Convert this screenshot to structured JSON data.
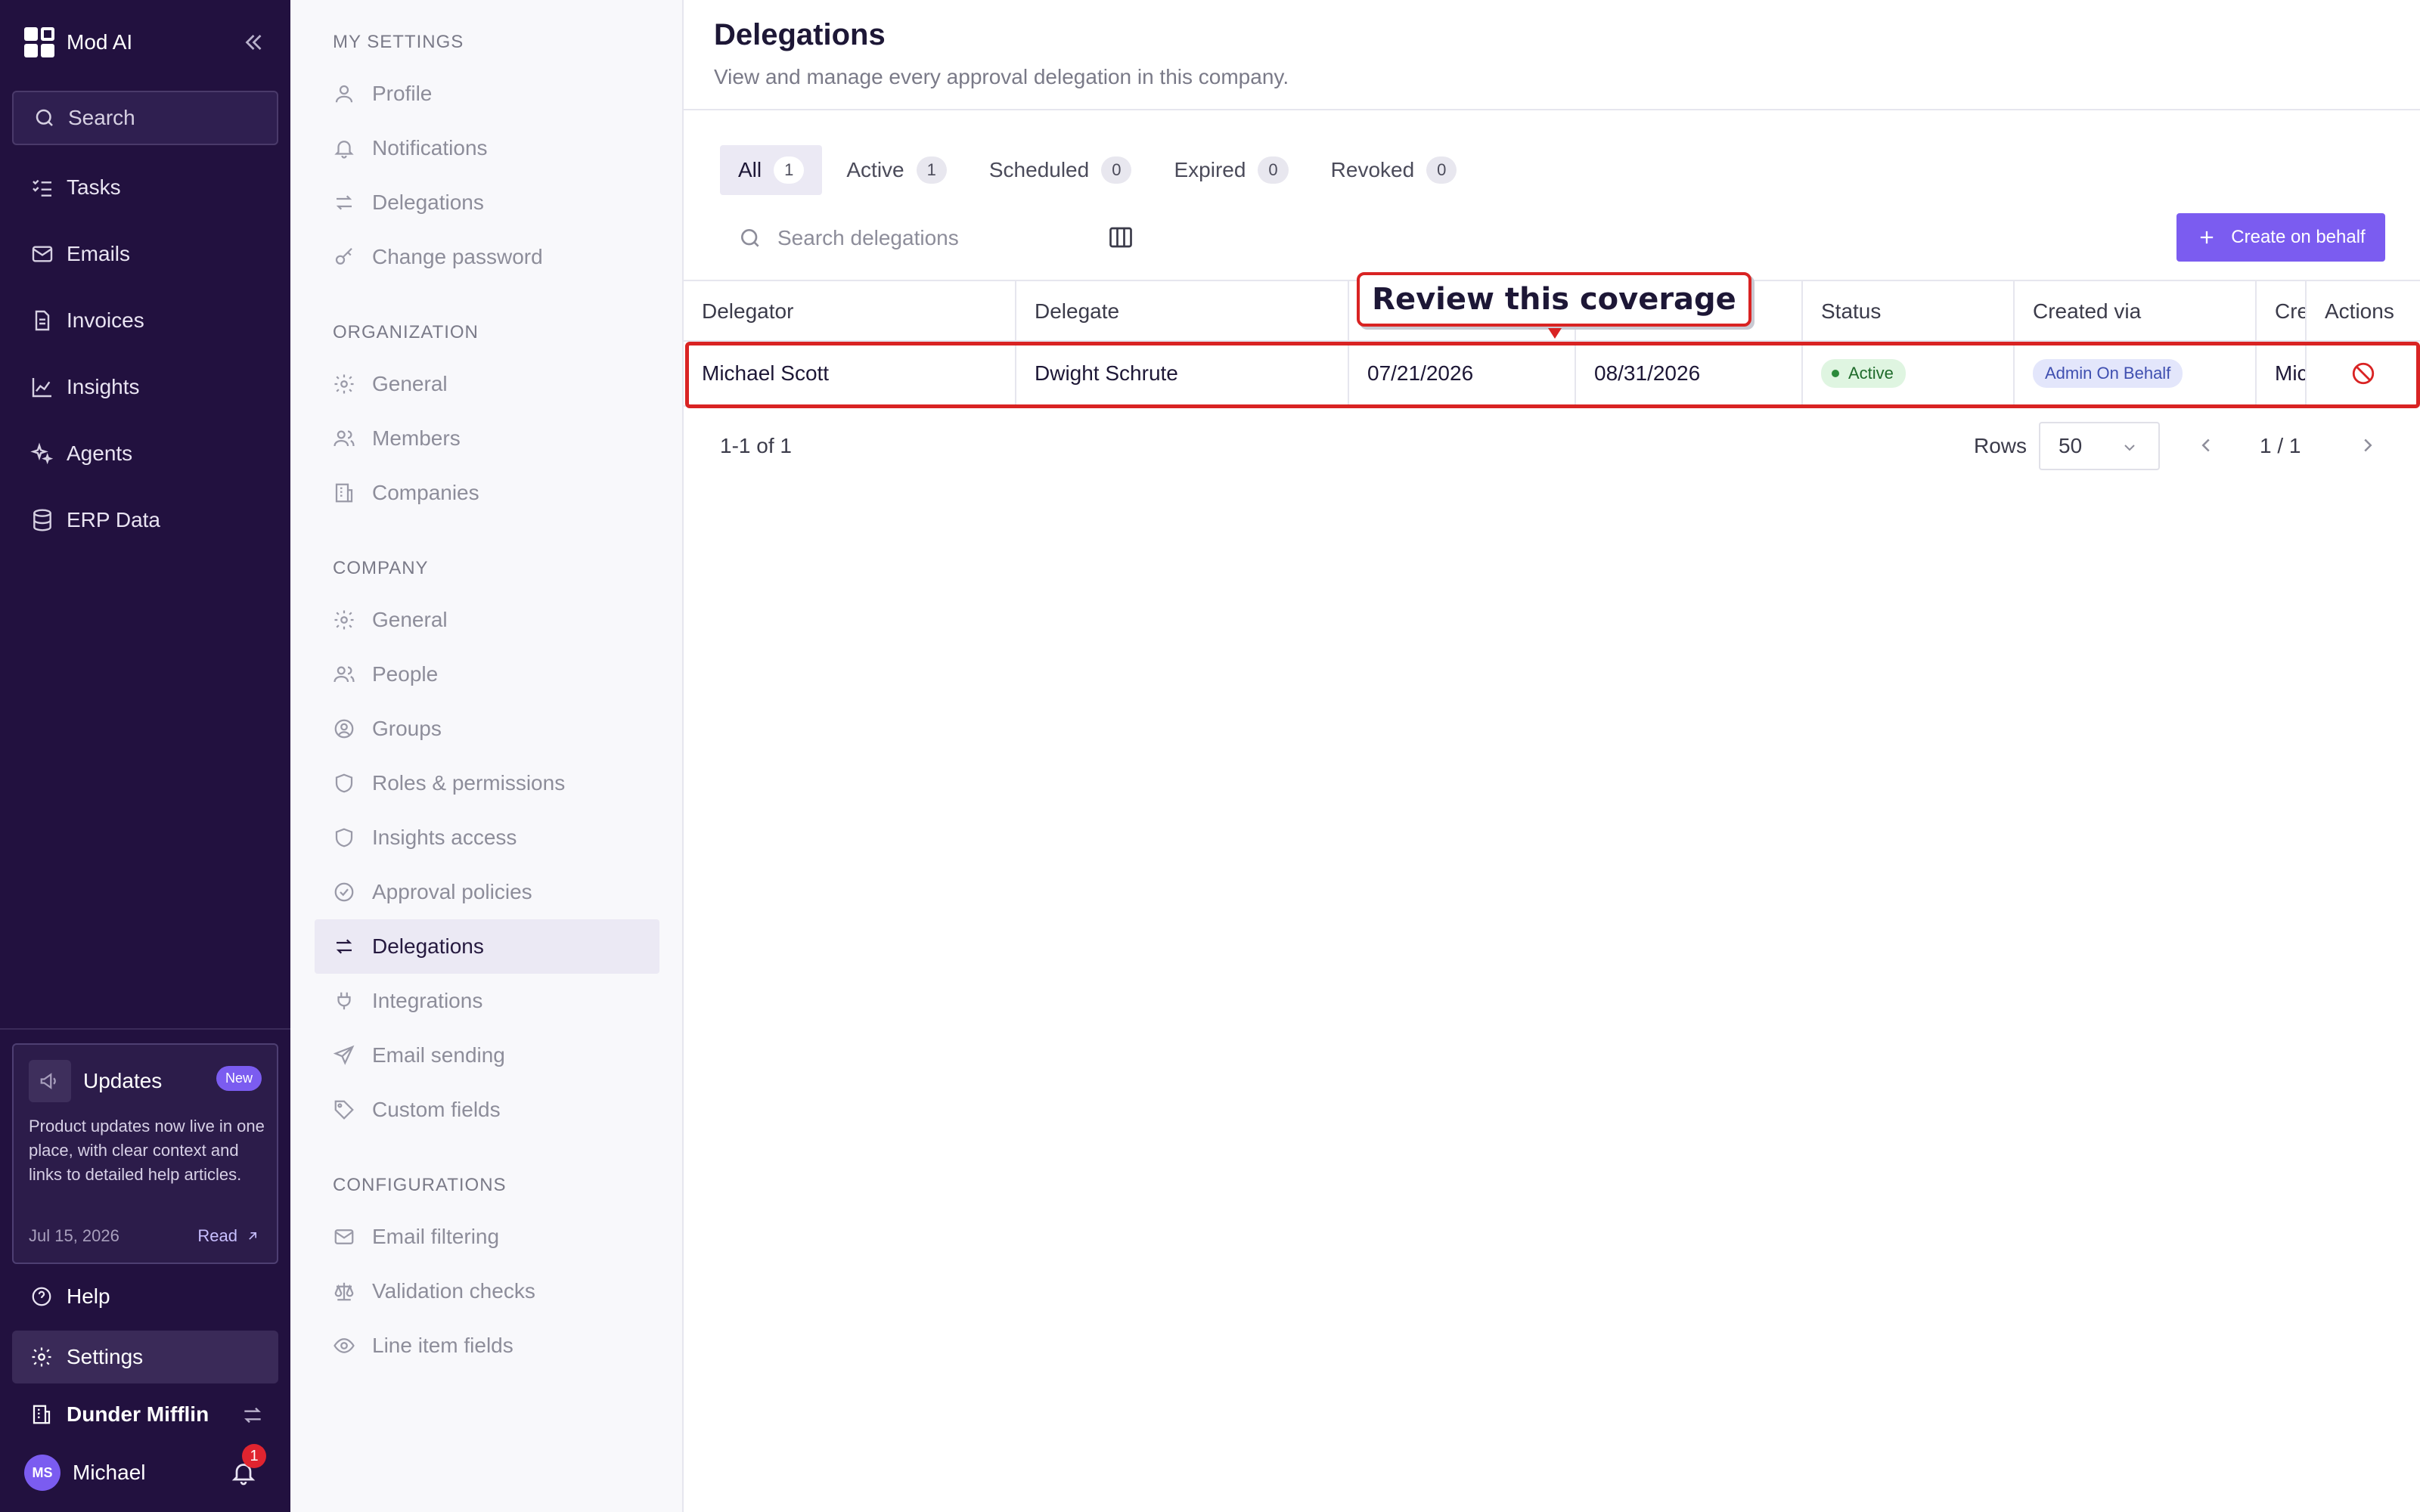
{
  "app": {
    "name": "Mod AI"
  },
  "sidebar": {
    "search_label": "Search",
    "items": [
      {
        "label": "Tasks",
        "icon": "tasks-icon"
      },
      {
        "label": "Emails",
        "icon": "mail-icon"
      },
      {
        "label": "Invoices",
        "icon": "document-icon"
      },
      {
        "label": "Insights",
        "icon": "chart-icon"
      },
      {
        "label": "Agents",
        "icon": "sparkle-icon"
      },
      {
        "label": "ERP Data",
        "icon": "database-icon"
      }
    ],
    "updates": {
      "title": "Updates",
      "badge": "New",
      "body": "Product updates now live in one place, with clear context and links to detailed help articles.",
      "date": "Jul 15, 2026",
      "read_label": "Read"
    },
    "help_label": "Help",
    "settings_label": "Settings",
    "company": "Dunder Mifflin",
    "user": {
      "initials": "MS",
      "name": "Michael",
      "notifications": "1"
    }
  },
  "settings_nav": {
    "sections": [
      {
        "title": "MY SETTINGS",
        "items": [
          "Profile",
          "Notifications",
          "Delegations",
          "Change password"
        ]
      },
      {
        "title": "ORGANIZATION",
        "items": [
          "General",
          "Members",
          "Companies"
        ]
      },
      {
        "title": "COMPANY",
        "items": [
          "General",
          "People",
          "Groups",
          "Roles & permissions",
          "Insights access",
          "Approval policies",
          "Delegations",
          "Integrations",
          "Email sending",
          "Custom fields"
        ]
      },
      {
        "title": "CONFIGURATIONS",
        "items": [
          "Email filtering",
          "Validation checks",
          "Line item fields"
        ]
      }
    ],
    "active_item": "Delegations"
  },
  "page": {
    "title": "Delegations",
    "subtitle": "View and manage every approval delegation in this company.",
    "tabs": [
      {
        "label": "All",
        "count": "1"
      },
      {
        "label": "Active",
        "count": "1"
      },
      {
        "label": "Scheduled",
        "count": "0"
      },
      {
        "label": "Expired",
        "count": "0"
      },
      {
        "label": "Revoked",
        "count": "0"
      }
    ],
    "search_placeholder": "Search delegations",
    "create_label": "Create on behalf",
    "columns": [
      "Delegator",
      "Delegate",
      "",
      "",
      "Status",
      "Created via",
      "Cre",
      "Actions"
    ],
    "rows": [
      {
        "delegator": "Michael Scott",
        "delegate": "Dwight Schrute",
        "start": "07/21/2026",
        "end": "08/31/2026",
        "status": "Active",
        "created_via": "Admin On Behalf",
        "created_by": "Mic"
      }
    ],
    "range_text": "1-1 of 1",
    "rows_label": "Rows",
    "rows_value": "50",
    "page_text": "1 / 1",
    "callout": "Review this coverage"
  },
  "colors": {
    "sidebar_bg": "#22113f",
    "accent": "#7b5cf0",
    "highlight": "#d92323"
  }
}
